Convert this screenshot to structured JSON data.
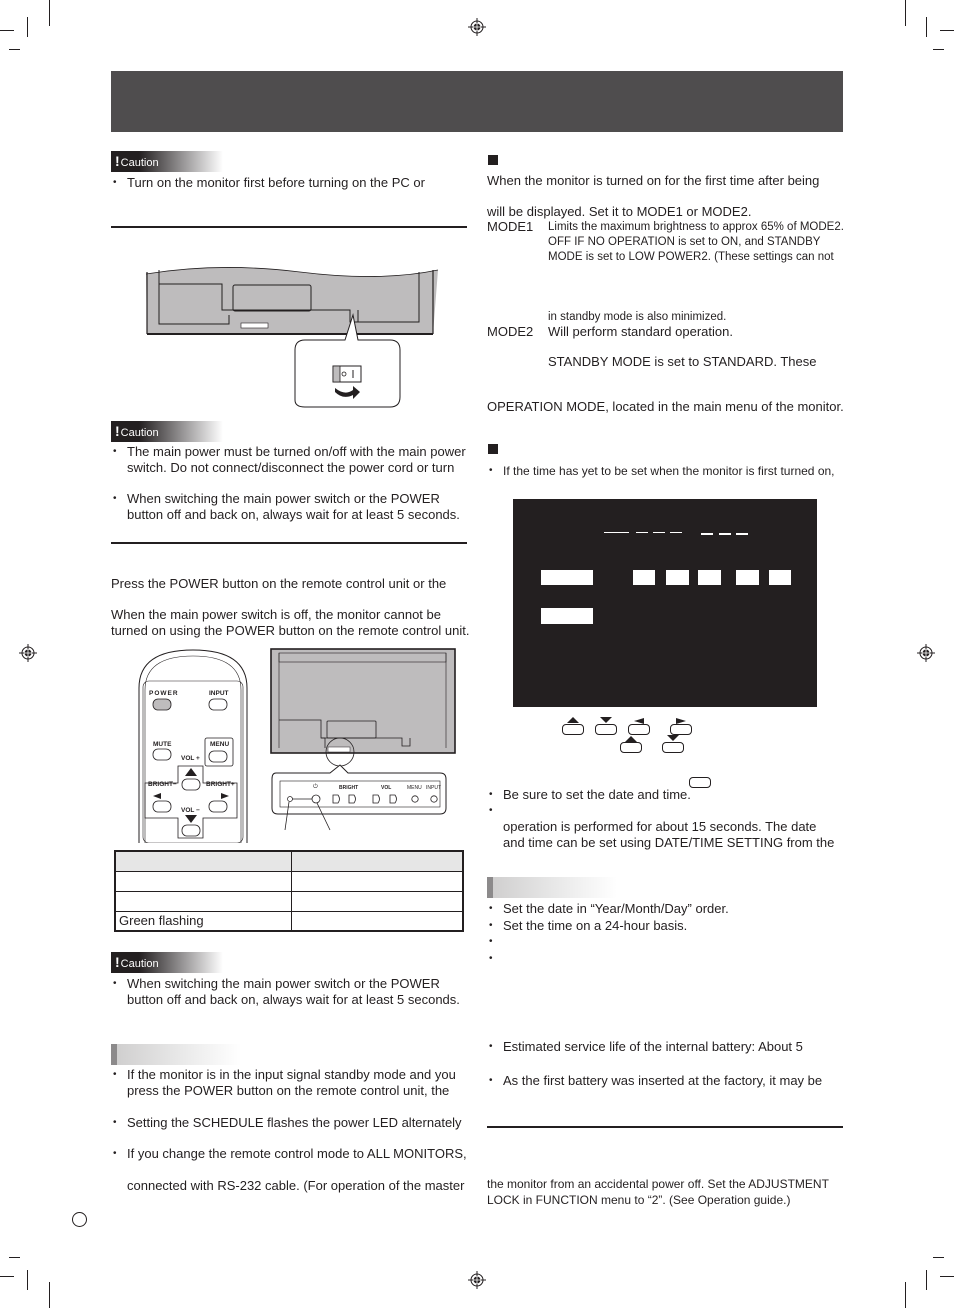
{
  "header": {
    "title": ""
  },
  "left": {
    "caution_label": "Caution",
    "caution_1": {
      "bullets": [
        "Turn on the monitor first before turning on the PC or"
      ]
    },
    "caution_2": {
      "bullets": [
        [
          "The main power must be turned on/off with the main power",
          "switch. Do not connect/disconnect the power cord or turn"
        ],
        [
          "When switching the main power switch or the POWER",
          "button off and back on, always wait for at least 5 seconds."
        ]
      ]
    },
    "power_section": {
      "para1": "Press the POWER button on the remote control unit or the",
      "para2": [
        "When the main power switch is off, the monitor cannot be",
        "turned on using the POWER button on the remote control unit."
      ]
    },
    "remote": {
      "power": "POWER",
      "input": "INPUT",
      "mute": "MUTE",
      "menu": "MENU",
      "vol_plus": "VOL +",
      "vol_minus": "VOL −",
      "bright_minus": "BRIGHT−",
      "bright_plus": "BRIGHT+"
    },
    "panel_keys": {
      "power": "⏻",
      "bright": "BRIGHT",
      "vol": "VOL",
      "menu": "MENU",
      "input": "INPUT"
    },
    "led_table": {
      "header": [
        "",
        ""
      ],
      "rows": [
        [
          "",
          ""
        ],
        [
          "",
          ""
        ],
        [
          "Green flashing",
          ""
        ]
      ]
    },
    "caution_3": {
      "bullets": [
        [
          "When switching the main power switch or the POWER",
          "button off and back on, always wait for at least 5 seconds."
        ]
      ]
    },
    "tips": {
      "bullets": [
        [
          "If the monitor is in the input signal standby mode and you",
          "press the POWER button on the remote control unit, the"
        ],
        [
          "Setting the SCHEDULE flashes the power LED alternately"
        ],
        [
          "If you change the remote control mode to ALL MONITORS,",
          "",
          "connected with RS-232 cable. (For operation of the master"
        ]
      ]
    }
  },
  "right": {
    "operation_mode": {
      "intro": [
        "When the monitor is turned on for the first time after being",
        "",
        "will be displayed. Set it to MODE1 or MODE2."
      ],
      "mode1_label": "MODE1",
      "mode1_lines": [
        "Limits the maximum brightness to approx 65% of MODE2.",
        "OFF IF NO OPERATION is set to ON, and STANDBY",
        "MODE is set to LOW POWER2. (These settings can not",
        "",
        "",
        "",
        "in standby mode is also minimized."
      ],
      "mode2_label": "MODE2",
      "mode2_lines": [
        "Will perform standard operation.",
        "",
        "STANDBY MODE is set to STANDARD. These"
      ],
      "footer": "OPERATION MODE, located in the main menu of the monitor."
    },
    "date_time": {
      "intro_bullet": "If the time has yet to be set when the monitor is first turned on,",
      "bullets": [
        [
          "Be sure to set the date and time."
        ],
        [
          "",
          "operation is performed for about 15 seconds. The date",
          "and time can be set using DATE/TIME SETTING from the"
        ]
      ]
    },
    "tips": {
      "bullets": [
        [
          "Set the date in “Year/Month/Day” order."
        ],
        [
          "Set the time on a 24-hour basis."
        ],
        [
          ""
        ],
        [
          ""
        ]
      ],
      "battery_bullets": [
        [
          "Estimated service life of the internal battery: About 5"
        ],
        [
          "As the first battery was inserted at the factory, it may be"
        ]
      ]
    },
    "adjustment_lock": [
      "the monitor from an accidental power off. Set the ADJUSTMENT",
      "LOCK in FUNCTION menu to “2”. (See Operation guide.)"
    ]
  }
}
